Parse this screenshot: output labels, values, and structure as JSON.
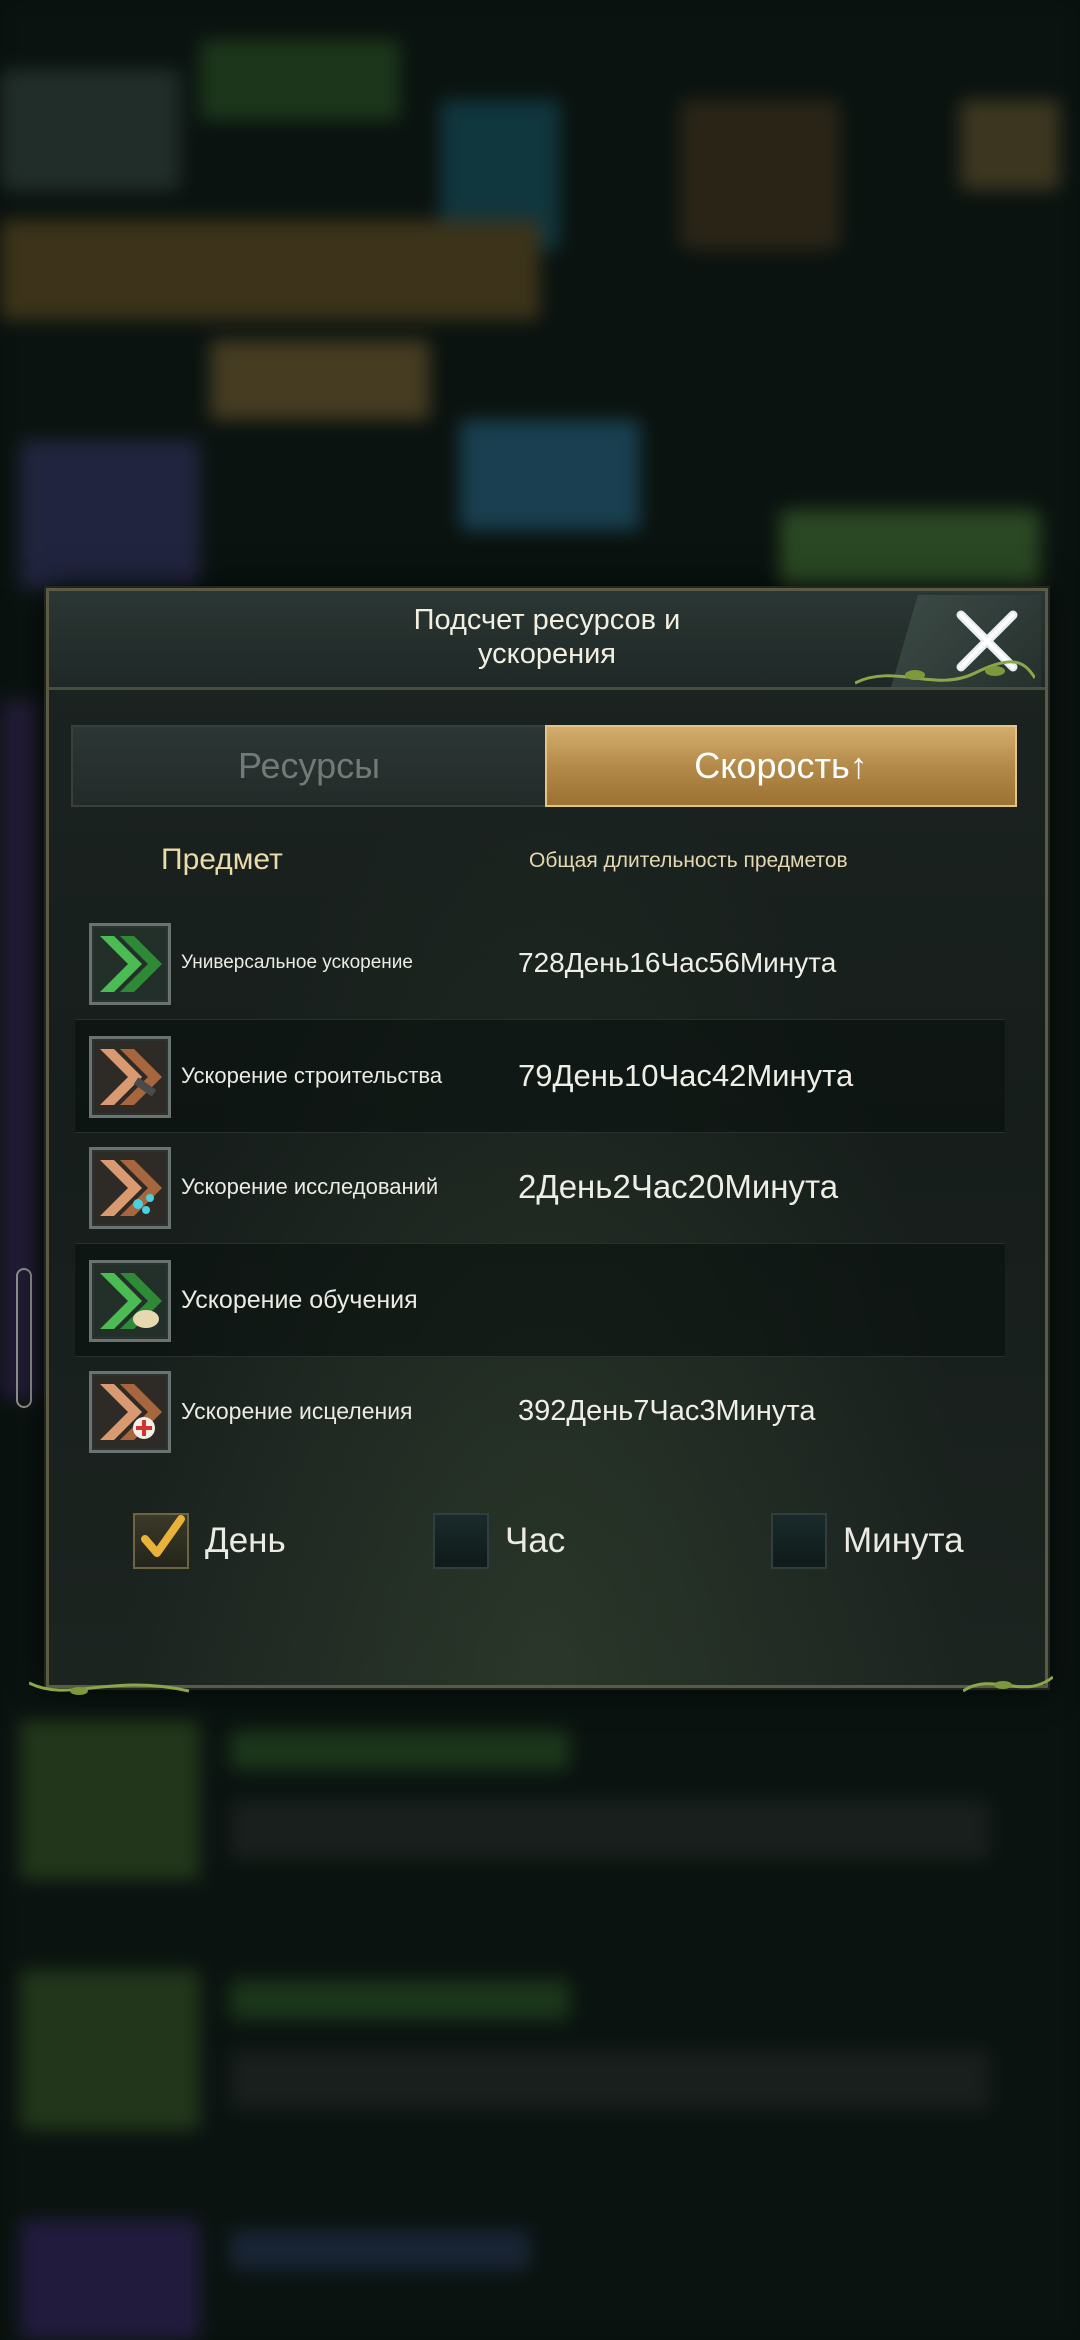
{
  "dialog": {
    "title_line1": "Подсчет ресурсов и",
    "title_line2": "ускорения"
  },
  "tabs": {
    "resources": "Ресурсы",
    "speed": "Скорость↑",
    "active": "speed"
  },
  "columns": {
    "item": "Предмет",
    "duration": "Общая длительность предметов"
  },
  "rows": [
    {
      "name": "Универсальное ускорение",
      "value": "728День16Час56Минута",
      "icon": "universal-speedup-icon"
    },
    {
      "name": "Ускорение строительства",
      "value": "79День10Час42Минута",
      "icon": "construction-speedup-icon"
    },
    {
      "name": "Ускорение исследований",
      "value": "2День2Час20Минута",
      "icon": "research-speedup-icon"
    },
    {
      "name": "Ускорение обучения",
      "value": "",
      "icon": "training-speedup-icon"
    },
    {
      "name": "Ускорение исцеления",
      "value": "392День7Час3Минута",
      "icon": "healing-speedup-icon"
    }
  ],
  "units": [
    {
      "label": "День",
      "checked": true
    },
    {
      "label": "Час",
      "checked": false
    },
    {
      "label": "Минута",
      "checked": false
    }
  ],
  "colors": {
    "accent_gold": "#b48a4a",
    "green_arrow": "#3fa447",
    "copper_arrow": "#c8825a"
  }
}
